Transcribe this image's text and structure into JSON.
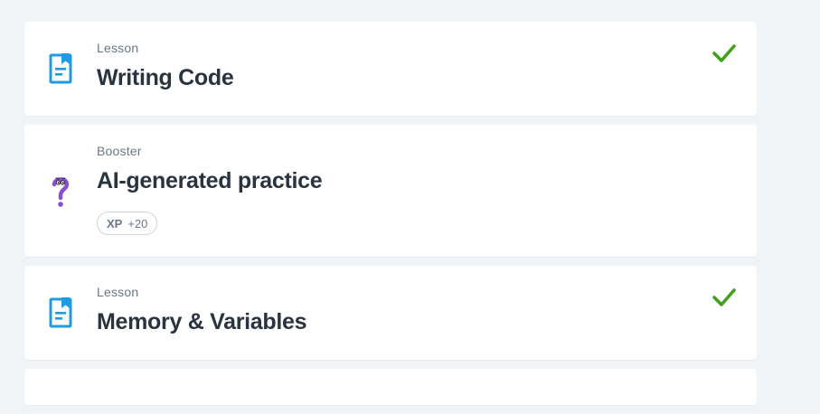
{
  "colors": {
    "background": "#f1f4f7",
    "card": "#ffffff",
    "lesson_icon": "#1f9be6",
    "booster_icon": "#8a4fcf",
    "check": "#3fa21a",
    "title_text": "#2a3340",
    "muted_text": "#6b7785"
  },
  "items": [
    {
      "type": "Lesson",
      "title": "Writing Code",
      "icon": "lesson-document-icon",
      "completed": true
    },
    {
      "type": "Booster",
      "title": "AI-generated practice",
      "icon": "question-mark-character-icon",
      "completed": false,
      "xp_label": "XP",
      "xp_value": "+20"
    },
    {
      "type": "Lesson",
      "title": "Memory & Variables",
      "icon": "lesson-document-icon",
      "completed": true
    }
  ]
}
